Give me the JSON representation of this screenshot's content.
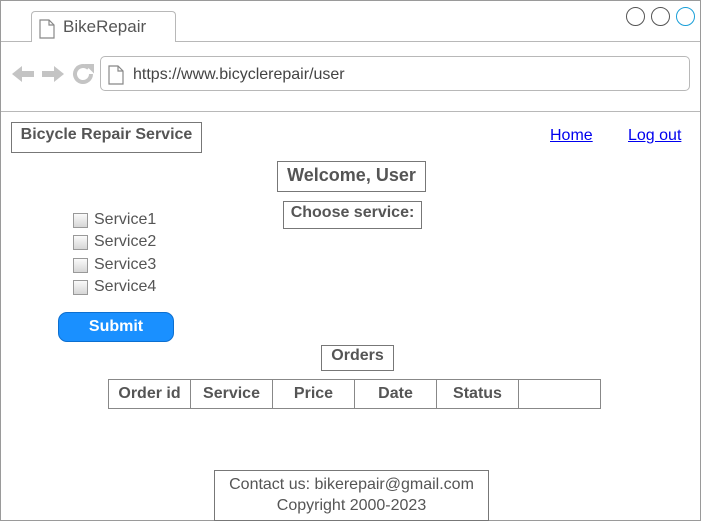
{
  "browser": {
    "tab_title": "BikeRepair",
    "url": "https://www.bicyclerepair/user",
    "window_controls": [
      "minimize-button",
      "maximize-button",
      "close-button"
    ]
  },
  "page": {
    "brand": "Bicycle Repair Service",
    "nav": {
      "home": "Home",
      "logout": "Log out"
    },
    "welcome": "Welcome, User",
    "choose_service": "Choose service:",
    "services": [
      {
        "label": "Service1",
        "checked": false
      },
      {
        "label": "Service2",
        "checked": false
      },
      {
        "label": "Service3",
        "checked": false
      },
      {
        "label": "Service4",
        "checked": false
      }
    ],
    "submit_label": "Submit",
    "orders_title": "Orders",
    "orders_table": {
      "headers": [
        "Order id",
        "Service",
        "Price",
        "Date",
        "Status",
        ""
      ]
    },
    "footer": {
      "contact": "Contact us: bikerepair@gmail.com",
      "copyright": "Copyright 2000-2023"
    }
  },
  "colors": {
    "accent": "#1a90ff",
    "link": "#0000ee",
    "close_control": "#1a9fd8"
  }
}
